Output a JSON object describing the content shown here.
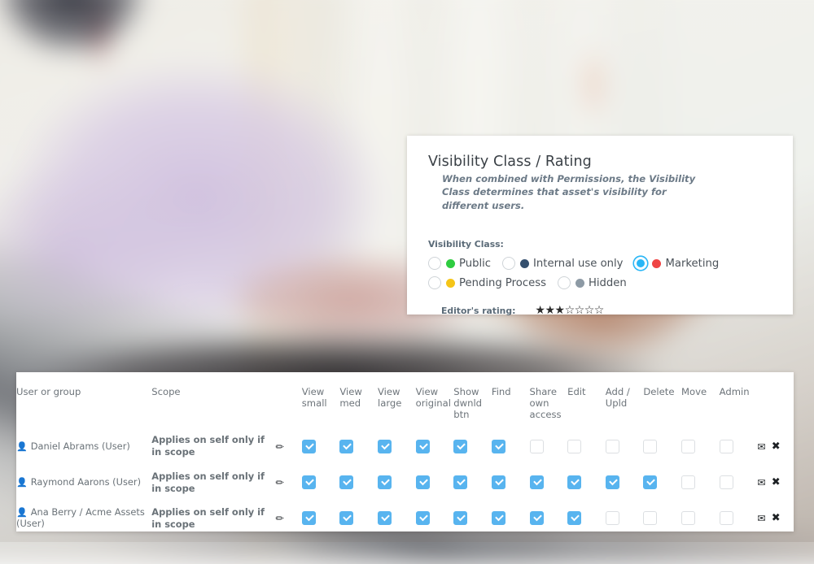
{
  "background": {
    "description": "blurred photo of person in lavender shirt typing on a laptop",
    "accent_blue": "#29b6f6",
    "checkbox_blue": "#58b4ef"
  },
  "visibility_panel": {
    "title": "Visibility Class / Rating",
    "subtitle": "When combined with Permissions, the Visibility Class determines that asset's visibility for different users.",
    "field_label": "Visibility Class:",
    "options": [
      {
        "label": "Public",
        "color": "#2ecc40",
        "selected": false
      },
      {
        "label": "Internal use only",
        "color": "#35506e",
        "selected": false
      },
      {
        "label": "Marketing",
        "color": "#ef4444",
        "selected": true
      },
      {
        "label": "Pending Process",
        "color": "#f5c518",
        "selected": false
      },
      {
        "label": "Hidden",
        "color": "#8d9aa5",
        "selected": false
      }
    ],
    "rating": {
      "label": "Editor's rating:",
      "value": 3,
      "max": 7,
      "filled_glyph": "★",
      "empty_glyph": "☆"
    }
  },
  "permissions_table": {
    "columns": [
      "User or group",
      "Scope",
      "",
      "View small",
      "View med",
      "View large",
      "View original",
      "Show dwnld btn",
      "Find",
      "Share own access",
      "Edit",
      "Add / Upld",
      "Delete",
      "Move",
      "Admin",
      ""
    ],
    "row_icons": {
      "person": "👤",
      "edit": "✏",
      "mail": "✉",
      "remove": "✖"
    },
    "rows": [
      {
        "user": "Daniel Abrams (User)",
        "scope": "Applies on self only if in scope",
        "permissions": [
          true,
          true,
          true,
          true,
          true,
          true,
          false,
          false,
          false,
          false,
          false,
          false
        ]
      },
      {
        "user": "Raymond Aarons (User)",
        "scope": "Applies on self only if in scope",
        "permissions": [
          true,
          true,
          true,
          true,
          true,
          true,
          true,
          true,
          true,
          true,
          false,
          false
        ]
      },
      {
        "user": "Ana Berry / Acme Assets (User)",
        "scope": "Applies on self only if in scope",
        "permissions": [
          true,
          true,
          true,
          true,
          true,
          true,
          true,
          true,
          false,
          false,
          false,
          false
        ]
      }
    ]
  }
}
